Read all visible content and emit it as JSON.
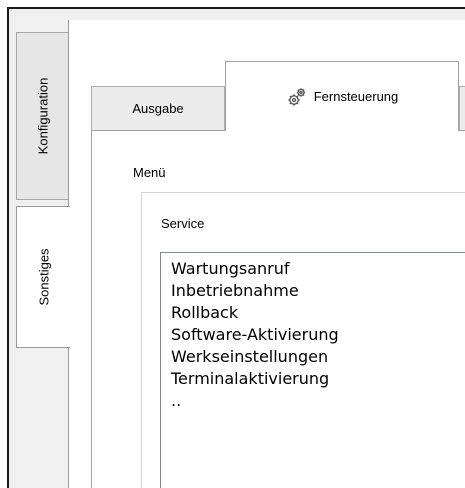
{
  "side_tabs": [
    {
      "label": "Konfiguration"
    },
    {
      "label": "Sonstiges",
      "selected": true
    }
  ],
  "tabs": [
    {
      "label": "Ausgabe"
    },
    {
      "label": "Fernsteuerung",
      "icon": "gears-icon",
      "selected": true
    }
  ],
  "menu": {
    "label": "Menü",
    "group_label": "Service",
    "items": [
      "Wartungsanruf",
      "Inbetriebnahme",
      "Rollback",
      "Software-Aktivierung",
      "Werkseinstellungen",
      "Terminalaktivierung",
      ".."
    ]
  }
}
